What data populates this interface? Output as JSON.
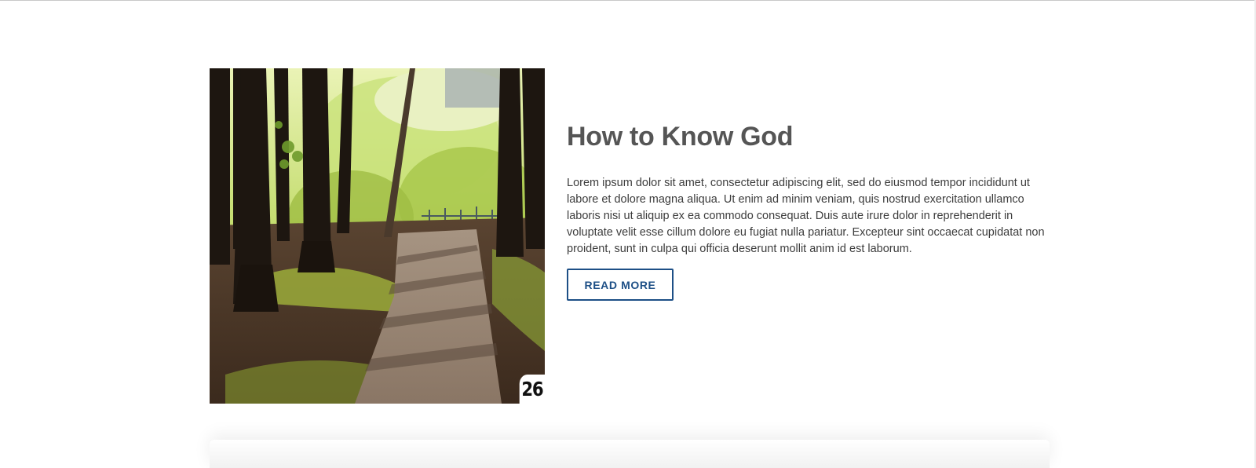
{
  "article": {
    "title": "How to Know God",
    "excerpt": "Lorem ipsum dolor sit amet, consectetur adipiscing elit, sed do eiusmod tempor incididunt ut labore et dolore magna aliqua. Ut enim ad minim veniam, quis nostrud exercitation ullamco laboris nisi ut aliquip ex ea commodo consequat. Duis aute irure dolor in reprehenderit in voluptate velit esse cillum dolore eu fugiat nulla pariatur. Excepteur sint occaecat cupidatat non proident, sunt in culpa qui officia deserunt mollit anim id est laborum.",
    "read_more_label": "READ MORE",
    "number": "26",
    "image_alt": "forest path"
  },
  "colors": {
    "accent": "#1d4f86",
    "title": "#555555",
    "text": "#3c3c3c"
  }
}
